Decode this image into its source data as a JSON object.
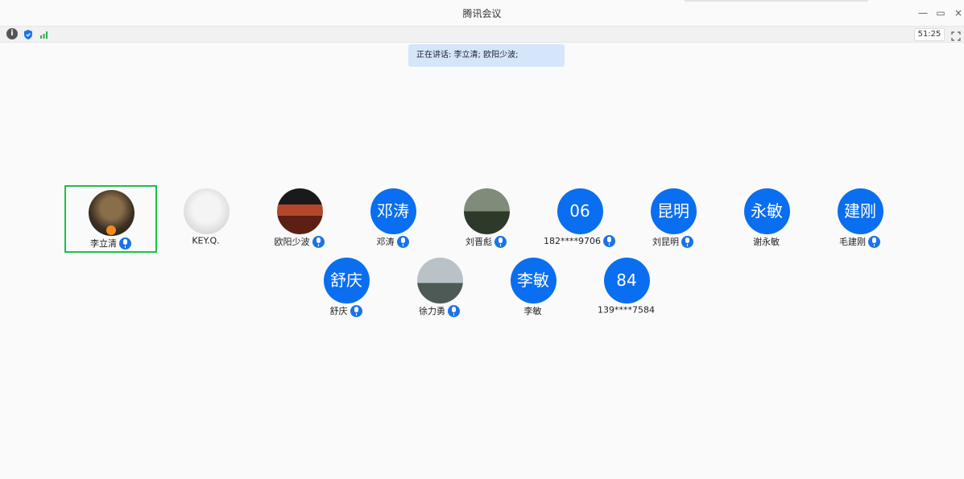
{
  "window": {
    "title": "腾讯会议",
    "minimize_glyph": "—",
    "restore_glyph": "▭",
    "close_glyph": "×"
  },
  "toolbar": {
    "info_glyph": "i",
    "timer": "51:25"
  },
  "speaking": {
    "text": "正在讲话: 李立清; 欧阳少波;"
  },
  "participants": [
    {
      "name": "李立清",
      "avatar": "photo",
      "mic": true,
      "active": true,
      "host": true
    },
    {
      "name": "KEY.Q.",
      "avatar": "photo",
      "mic": false
    },
    {
      "name": "欧阳少波",
      "avatar": "photo",
      "mic": true
    },
    {
      "name": "邓涛",
      "avatar_text": "邓涛",
      "mic": true
    },
    {
      "name": "刘晋彪",
      "avatar": "photo",
      "mic": true
    },
    {
      "name": "182****9706",
      "avatar_text": "06",
      "mic": true
    },
    {
      "name": "刘昆明",
      "avatar_text": "昆明",
      "mic": true
    },
    {
      "name": "谢永敏",
      "avatar_text": "永敏",
      "mic": false
    },
    {
      "name": "毛建刚",
      "avatar_text": "建刚",
      "mic": true
    },
    {
      "name": "舒庆",
      "avatar_text": "舒庆",
      "mic": true
    },
    {
      "name": "徐力勇",
      "avatar": "photo",
      "mic": true
    },
    {
      "name": "李敏",
      "avatar_text": "李敏",
      "mic": false
    },
    {
      "name": "139****7584",
      "avatar_text": "84",
      "mic": false
    }
  ],
  "colors": {
    "avatar_bg": "#0a6ef0",
    "mic": "#1a73e8",
    "active_border": "#1fbf4a",
    "speaking_bg": "#d5e6fb",
    "host_badge": "#f38a1a"
  }
}
